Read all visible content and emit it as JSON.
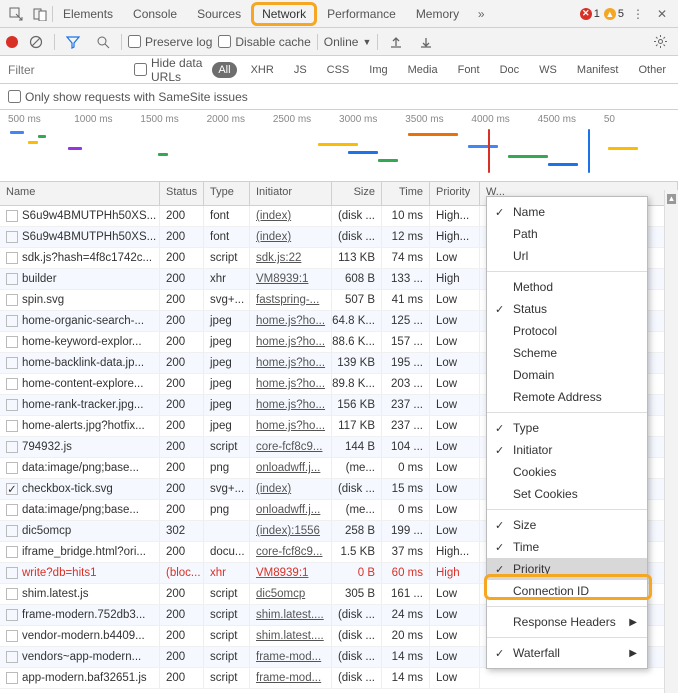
{
  "tabs": [
    "Elements",
    "Console",
    "Sources",
    "Network",
    "Performance",
    "Memory"
  ],
  "active_tab": "Network",
  "errors": {
    "error_count": "1",
    "warn_count": "5"
  },
  "toolbar": {
    "preserve_log": "Preserve log",
    "disable_cache": "Disable cache",
    "online": "Online"
  },
  "filter": {
    "placeholder": "Filter",
    "hide_data": "Hide data URLs",
    "types": [
      "All",
      "XHR",
      "JS",
      "CSS",
      "Img",
      "Media",
      "Font",
      "Doc",
      "WS",
      "Manifest",
      "Other"
    ]
  },
  "samesite": "Only show requests with SameSite issues",
  "timeline_ticks": [
    "500 ms",
    "1000 ms",
    "1500 ms",
    "2000 ms",
    "2500 ms",
    "3000 ms",
    "3500 ms",
    "4000 ms",
    "4500 ms",
    "50"
  ],
  "headers": {
    "name": "Name",
    "status": "Status",
    "type": "Type",
    "initiator": "Initiator",
    "size": "Size",
    "time": "Time",
    "priority": "Priority",
    "waterfall": "W..."
  },
  "rows": [
    {
      "name": "S6u9w4BMUTPHh50XS...",
      "status": "200",
      "type": "font",
      "initiator": "(index)",
      "size": "(disk ...",
      "time": "10 ms",
      "priority": "High..."
    },
    {
      "name": "S6u9w4BMUTPHh50XS...",
      "status": "200",
      "type": "font",
      "initiator": "(index)",
      "size": "(disk ...",
      "time": "12 ms",
      "priority": "High..."
    },
    {
      "name": "sdk.js?hash=4f8c1742c...",
      "status": "200",
      "type": "script",
      "initiator": "sdk.js:22",
      "size": "113 KB",
      "time": "74 ms",
      "priority": "Low"
    },
    {
      "name": "builder",
      "status": "200",
      "type": "xhr",
      "initiator": "VM8939:1",
      "size": "608 B",
      "time": "133 ...",
      "priority": "High"
    },
    {
      "name": "spin.svg",
      "status": "200",
      "type": "svg+...",
      "initiator": "fastspring-...",
      "size": "507 B",
      "time": "41 ms",
      "priority": "Low"
    },
    {
      "name": "home-organic-search-...",
      "status": "200",
      "type": "jpeg",
      "initiator": "home.js?ho...",
      "size": "64.8 K...",
      "time": "125 ...",
      "priority": "Low"
    },
    {
      "name": "home-keyword-explor...",
      "status": "200",
      "type": "jpeg",
      "initiator": "home.js?ho...",
      "size": "88.6 K...",
      "time": "157 ...",
      "priority": "Low"
    },
    {
      "name": "home-backlink-data.jp...",
      "status": "200",
      "type": "jpeg",
      "initiator": "home.js?ho...",
      "size": "139 KB",
      "time": "195 ...",
      "priority": "Low"
    },
    {
      "name": "home-content-explore...",
      "status": "200",
      "type": "jpeg",
      "initiator": "home.js?ho...",
      "size": "89.8 K...",
      "time": "203 ...",
      "priority": "Low"
    },
    {
      "name": "home-rank-tracker.jpg...",
      "status": "200",
      "type": "jpeg",
      "initiator": "home.js?ho...",
      "size": "156 KB",
      "time": "237 ...",
      "priority": "Low"
    },
    {
      "name": "home-alerts.jpg?hotfix...",
      "status": "200",
      "type": "jpeg",
      "initiator": "home.js?ho...",
      "size": "117 KB",
      "time": "237 ...",
      "priority": "Low"
    },
    {
      "name": "794932.js",
      "status": "200",
      "type": "script",
      "initiator": "core-fcf8c9...",
      "size": "144 B",
      "time": "104 ...",
      "priority": "Low"
    },
    {
      "name": "data:image/png;base...",
      "status": "200",
      "type": "png",
      "initiator": "onloadwff.j...",
      "size": "(me...",
      "time": "0 ms",
      "priority": "Low"
    },
    {
      "name": "checkbox-tick.svg",
      "status": "200",
      "type": "svg+...",
      "initiator": "(index)",
      "size": "(disk ...",
      "time": "15 ms",
      "priority": "Low",
      "checked": true
    },
    {
      "name": "data:image/png;base...",
      "status": "200",
      "type": "png",
      "initiator": "onloadwff.j...",
      "size": "(me...",
      "time": "0 ms",
      "priority": "Low"
    },
    {
      "name": "dic5omcp",
      "status": "302",
      "type": "",
      "initiator": "(index):1556",
      "size": "258 B",
      "time": "199 ...",
      "priority": "Low"
    },
    {
      "name": "iframe_bridge.html?ori...",
      "status": "200",
      "type": "docu...",
      "initiator": "core-fcf8c9...",
      "size": "1.5 KB",
      "time": "37 ms",
      "priority": "High..."
    },
    {
      "name": "write?db=hits1",
      "status": "(bloc...",
      "type": "xhr",
      "initiator": "VM8939:1",
      "size": "0 B",
      "time": "60 ms",
      "priority": "High",
      "red": true
    },
    {
      "name": "shim.latest.js",
      "status": "200",
      "type": "script",
      "initiator": "dic5omcp",
      "size": "305 B",
      "time": "161 ...",
      "priority": "Low"
    },
    {
      "name": "frame-modern.752db3...",
      "status": "200",
      "type": "script",
      "initiator": "shim.latest....",
      "size": "(disk ...",
      "time": "24 ms",
      "priority": "Low"
    },
    {
      "name": "vendor-modern.b4409...",
      "status": "200",
      "type": "script",
      "initiator": "shim.latest....",
      "size": "(disk ...",
      "time": "20 ms",
      "priority": "Low"
    },
    {
      "name": "vendors~app-modern...",
      "status": "200",
      "type": "script",
      "initiator": "frame-mod...",
      "size": "(disk ...",
      "time": "14 ms",
      "priority": "Low"
    },
    {
      "name": "app-modern.baf32651.js",
      "status": "200",
      "type": "script",
      "initiator": "frame-mod...",
      "size": "(disk ...",
      "time": "14 ms",
      "priority": "Low"
    }
  ],
  "menu": {
    "items": [
      {
        "label": "Name",
        "checked": true
      },
      {
        "label": "Path"
      },
      {
        "label": "Url"
      },
      {
        "sep": true
      },
      {
        "label": "Method"
      },
      {
        "label": "Status",
        "checked": true
      },
      {
        "label": "Protocol"
      },
      {
        "label": "Scheme"
      },
      {
        "label": "Domain"
      },
      {
        "label": "Remote Address"
      },
      {
        "sep": true
      },
      {
        "label": "Type",
        "checked": true
      },
      {
        "label": "Initiator",
        "checked": true
      },
      {
        "label": "Cookies"
      },
      {
        "label": "Set Cookies"
      },
      {
        "sep": true
      },
      {
        "label": "Size",
        "checked": true
      },
      {
        "label": "Time",
        "checked": true
      },
      {
        "label": "Priority",
        "checked": true,
        "highlighted": true
      },
      {
        "label": "Connection ID"
      },
      {
        "sep": true
      },
      {
        "label": "Response Headers",
        "arrow": true
      },
      {
        "sep": true
      },
      {
        "label": "Waterfall",
        "checked": true,
        "arrow": true
      }
    ]
  }
}
